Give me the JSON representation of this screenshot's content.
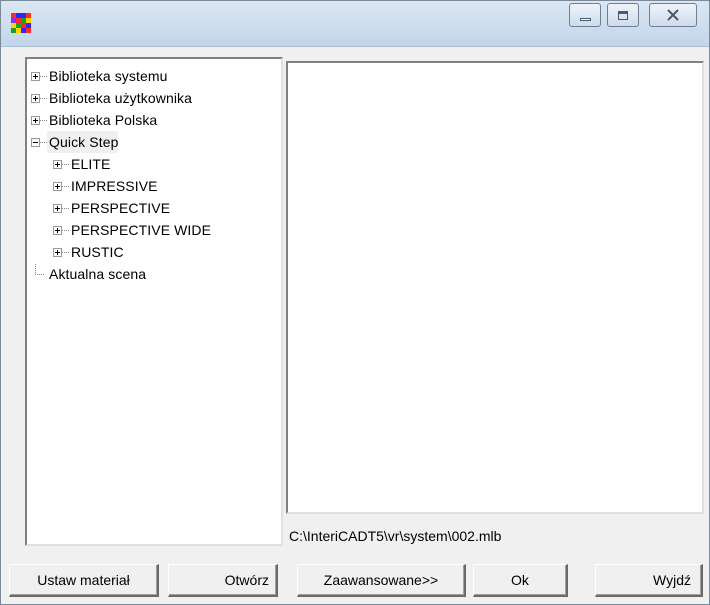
{
  "window": {
    "title": "",
    "controls": {
      "minimize": "—",
      "maximize": "□",
      "close": "✕"
    }
  },
  "tree": {
    "nodes": [
      {
        "label": "Biblioteka systemu",
        "level": 0,
        "expander": "plus"
      },
      {
        "label": "Biblioteka użytkownika",
        "level": 0,
        "expander": "plus"
      },
      {
        "label": "Biblioteka Polska",
        "level": 0,
        "expander": "plus"
      },
      {
        "label": "Quick Step",
        "level": 0,
        "expander": "minus",
        "selected": true
      },
      {
        "label": "ELITE",
        "level": 1,
        "expander": "plus"
      },
      {
        "label": "IMPRESSIVE",
        "level": 1,
        "expander": "plus"
      },
      {
        "label": "PERSPECTIVE",
        "level": 1,
        "expander": "plus"
      },
      {
        "label": "PERSPECTIVE WIDE",
        "level": 1,
        "expander": "plus"
      },
      {
        "label": "RUSTIC",
        "level": 1,
        "expander": "plus"
      },
      {
        "label": "Aktualna scena",
        "level": 0,
        "expander": "none"
      }
    ]
  },
  "preview": {
    "path": "C:\\InteriCADT5\\vr\\system\\002.mlb"
  },
  "buttons": {
    "set_material": "Ustaw materiał",
    "open": "Otwórz",
    "advanced": "Zaawansowane>>",
    "ok": "Ok",
    "exit": "Wyjdź"
  },
  "icons": {
    "app": "app-mosaic-icon",
    "minimize": "minimize-icon",
    "maximize": "maximize-icon",
    "close": "close-icon"
  },
  "colors": {
    "titlebar_top": "#dce7f3",
    "titlebar_bottom": "#c3d5e9",
    "window_bg": "#f0f0f0",
    "panel_bg": "#ffffff"
  }
}
